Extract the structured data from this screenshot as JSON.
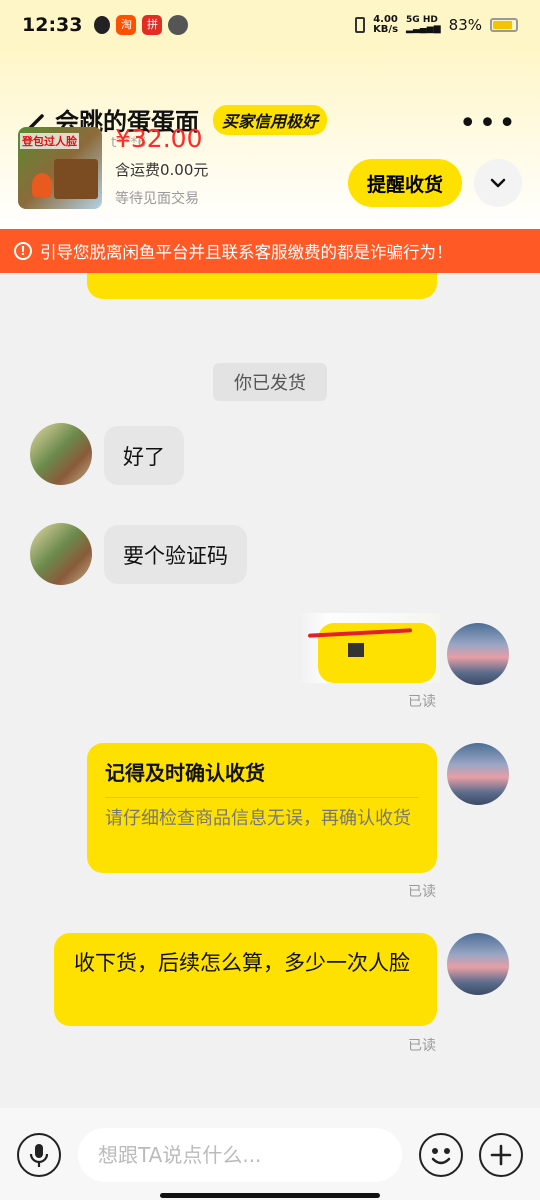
{
  "status_bar": {
    "time": "12:33",
    "app_icons": [
      "qq-icon",
      "taobao-icon",
      "pinduoduo-icon",
      "wechat-icon"
    ],
    "net_speed": "4.00",
    "net_unit": "KB/s",
    "network": "5G HD",
    "battery": "83%"
  },
  "header": {
    "shop_name": "会跳的蛋蛋面",
    "credit_badge": "买家信用极好",
    "member_name": "会员名：t***6",
    "more": "•••"
  },
  "product": {
    "price": "¥32.00",
    "shipping": "含运费0.00元",
    "status": "等待见面交易",
    "thumb_caption": "登包过人脸",
    "remind_button": "提醒收货"
  },
  "warning": {
    "text": "引导您脱离闲鱼平台并且联系客服缴费的都是诈骗行为！"
  },
  "chat": {
    "system_message": "你已发货",
    "messages": [
      {
        "side": "left",
        "text": "好了"
      },
      {
        "side": "left",
        "text": "要个验证码"
      },
      {
        "side": "right",
        "text": "",
        "read": "已读"
      },
      {
        "side": "right",
        "card_title": "记得及时确认收货",
        "card_desc": "请仔细检查商品信息无误，再确认收货",
        "read": "已读"
      },
      {
        "side": "right",
        "text": "收下货，后续怎么算，多少一次人脸",
        "read": "已读"
      }
    ]
  },
  "input": {
    "placeholder": "想跟TA说点什么..."
  },
  "colors": {
    "accent": "#ffe100",
    "warning": "#ff5a26",
    "price": "#ff2a2a"
  }
}
